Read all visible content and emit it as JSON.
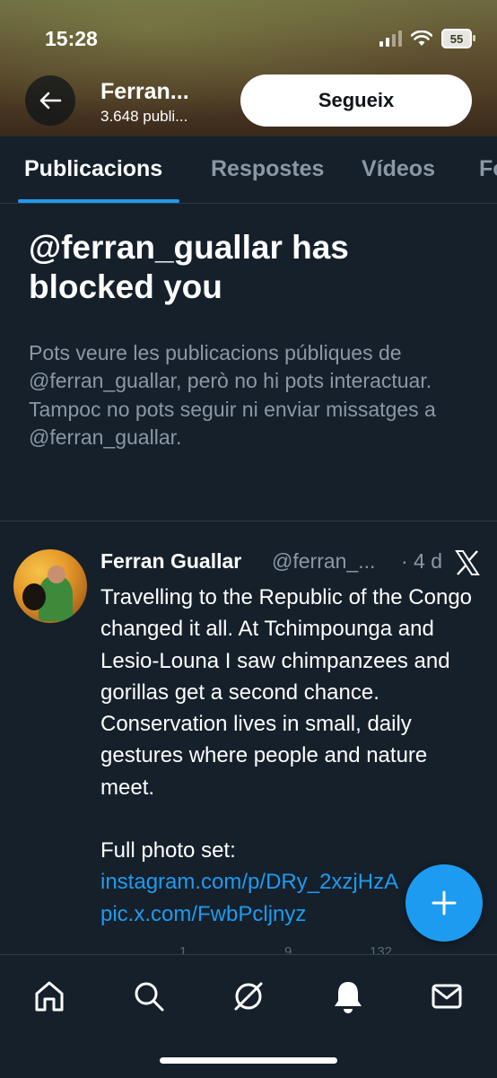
{
  "status_bar": {
    "time": "15:28",
    "battery": "55"
  },
  "header": {
    "name": "Ferran...",
    "post_count": "3.648 publi...",
    "follow_label": "Segueix"
  },
  "tabs": [
    {
      "label": "Publicacions",
      "active": true
    },
    {
      "label": "Respostes",
      "active": false
    },
    {
      "label": "Vídeos",
      "active": false
    },
    {
      "label": "Fo",
      "active": false
    }
  ],
  "blocked_notice": {
    "title": "@ferran_guallar has blocked you",
    "description": "Pots veure les publicacions públiques de @ferran_guallar, però no hi pots interactuar. Tampoc no pots seguir ni enviar missatges a @ferran_guallar."
  },
  "tweet": {
    "display_name": "Ferran Guallar",
    "handle": "@ferran_...",
    "time": "· 4 d",
    "text": "Travelling to the Republic of the Congo changed it all. At Tchimpounga and Lesio-Louna I saw chimpanzees and gorillas get a second chance. Conservation lives in small, daily gestures where people and nature meet.",
    "links_prefix": "Full photo set:",
    "link1": "instagram.com/p/DRy_2xzjHzA",
    "link2": "pic.x.com/FwbPcljnyz",
    "stats": {
      "retweets": "1",
      "likes": "9",
      "views": "132"
    }
  },
  "colors": {
    "accent": "#1d9bf0",
    "background": "#15202b",
    "muted": "#8b98a5"
  },
  "nav_icons": [
    "home-icon",
    "search-icon",
    "grok-icon",
    "notifications-icon",
    "messages-icon"
  ]
}
